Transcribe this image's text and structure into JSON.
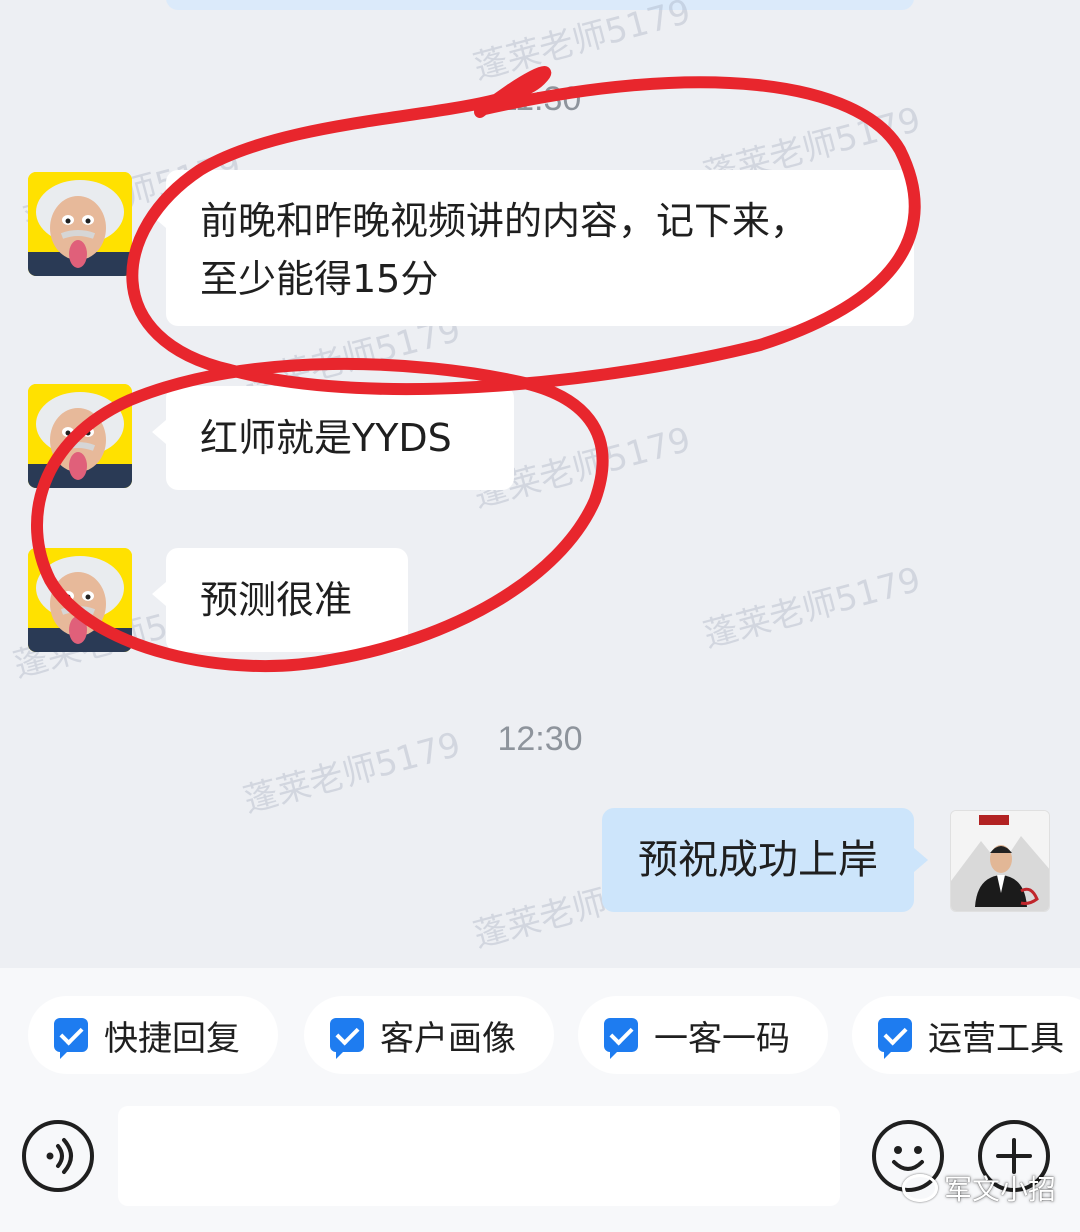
{
  "chat": {
    "timestamps": [
      "11:30",
      "12:30"
    ],
    "messages": [
      {
        "from": "contact",
        "text": "前晚和昨晚视频讲的内容，记下来，\n至少能得15分"
      },
      {
        "from": "contact",
        "text": "红师就是YYDS"
      },
      {
        "from": "contact",
        "text": "预测很准"
      },
      {
        "from": "self",
        "text": "预祝成功上岸"
      }
    ],
    "watermark": "蓬莱老师5179"
  },
  "quick_bar": {
    "items": [
      "快捷回复",
      "客户画像",
      "一客一码",
      "运营工具"
    ]
  },
  "input": {
    "placeholder": ""
  },
  "icons": {
    "voice": "voice-icon",
    "emoji": "emoji-icon",
    "plus": "plus-icon",
    "check": "check-icon"
  },
  "brand_watermark": "军文小招",
  "colors": {
    "background": "#edeff3",
    "self_bubble": "#cde5fb",
    "accent": "#1e7cf0",
    "annotation": "#e8262d"
  }
}
